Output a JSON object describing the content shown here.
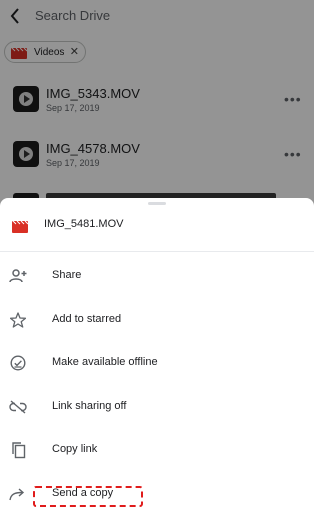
{
  "search": {
    "placeholder": "Search Drive"
  },
  "filter_chip": {
    "label": "Videos",
    "close": "✕"
  },
  "files": [
    {
      "name": "IMG_5343.MOV",
      "date": "Sep 17, 2019"
    },
    {
      "name": "IMG_4578.MOV",
      "date": "Sep 17, 2019"
    }
  ],
  "sheet": {
    "title": "IMG_5481.MOV",
    "items": [
      {
        "label": "Share",
        "icon": "add-person-icon"
      },
      {
        "label": "Add to starred",
        "icon": "star-outline-icon"
      },
      {
        "label": "Make available offline",
        "icon": "offline-check-icon"
      },
      {
        "label": "Link sharing off",
        "icon": "link-off-icon"
      },
      {
        "label": "Copy link",
        "icon": "copy-icon"
      },
      {
        "label": "Send a copy",
        "icon": "send-arrow-icon"
      }
    ]
  },
  "colors": {
    "video_red": "#d93025",
    "highlight": "#e01b1b",
    "icon_gray": "#5f6368"
  }
}
